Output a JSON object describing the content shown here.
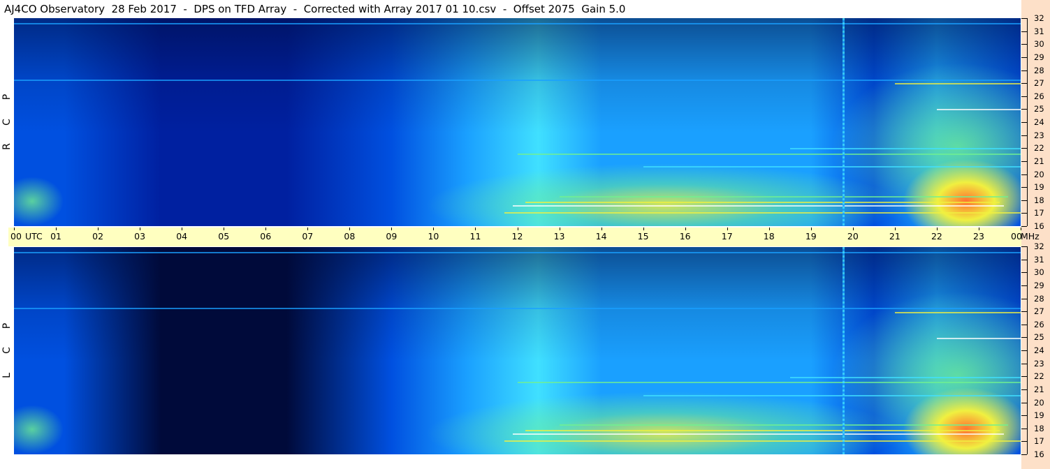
{
  "title": "AJ4CO Observatory  28 Feb 2017  -  DPS on TFD Array  -  Corrected with Array 2017 01 10.csv  -  Offset 2075  Gain 5.0",
  "panels": [
    {
      "id": "rcp",
      "side_label": [
        "R",
        "C",
        "P"
      ]
    },
    {
      "id": "lcp",
      "side_label": [
        "L",
        "C",
        "P"
      ]
    }
  ],
  "chart_data": {
    "type": "heatmap",
    "title": "AJ4CO Observatory  28 Feb 2017  -  DPS on TFD Array  -  Corrected with Array 2017 01 10.csv  -  Offset 2075  Gain 5.0",
    "xlabel": "UTC",
    "ylabel": "MHz",
    "x_ticks": [
      "00",
      "01",
      "02",
      "03",
      "04",
      "05",
      "06",
      "07",
      "08",
      "09",
      "10",
      "11",
      "12",
      "13",
      "14",
      "15",
      "16",
      "17",
      "18",
      "19",
      "20",
      "21",
      "22",
      "23",
      "00"
    ],
    "x_range_hours": [
      0,
      24
    ],
    "y_ticks": [
      "16",
      "17",
      "18",
      "19",
      "20",
      "21",
      "22",
      "23",
      "24",
      "25",
      "26",
      "27",
      "28",
      "29",
      "30",
      "31",
      "32"
    ],
    "y_range_mhz": [
      16,
      32
    ],
    "series": [
      {
        "name": "RCP",
        "colormap": "jet",
        "description_hours": {
          "quiet_low": [
            2,
            10
          ],
          "active": [
            12,
            24
          ]
        }
      },
      {
        "name": "LCP",
        "colormap": "jet",
        "description_hours": {
          "quiet_low": [
            2,
            10
          ],
          "active": [
            12,
            24
          ]
        }
      }
    ],
    "features": [
      {
        "kind": "interference-line",
        "utc_hour": 19.75
      },
      {
        "kind": "hot-region",
        "utc_hours": [
          22.2,
          23.4
        ],
        "mhz": [
          17,
          19.3
        ]
      }
    ],
    "colors": {
      "deep": "#000a3a",
      "dark": "#0020a0",
      "mid": "#0050e0",
      "bright": "#1aa0ff",
      "cyan": "#40e0ff",
      "green": "#70f090",
      "yellow": "#f0f040",
      "hot": "#ff7030"
    }
  }
}
